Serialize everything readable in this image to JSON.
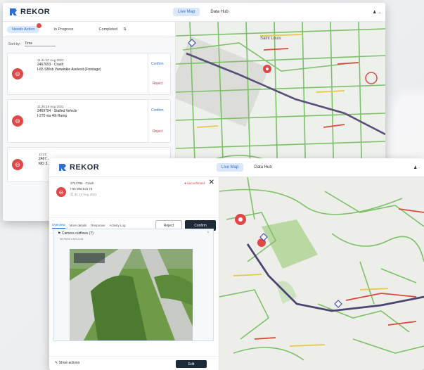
{
  "app": {
    "name": "REKOR",
    "nav": [
      "Live Map",
      "Data Hub"
    ]
  },
  "back": {
    "subtabs": [
      "Needs Action",
      "In Progress",
      "Completed"
    ],
    "sort_label": "Sort by:",
    "sort_value": "Time",
    "cards": [
      {
        "time": "11:41:37 Aug 2021",
        "id": "2467653 · Crash",
        "desc": "I-65 SB/sb Vanwinkle Ave/exit (Frontage)",
        "confirm": "Confirm",
        "reject": "Reject"
      },
      {
        "time": "11:36:18 Aug 2021",
        "id": "2469794 · Stalled Vehicle",
        "desc": "I-270 via 4th Ramp",
        "confirm": "Confirm",
        "reject": "Reject"
      },
      {
        "time": "11:21:",
        "id": "2467...",
        "desc": "MO 3...",
        "confirm": "",
        "reject": ""
      }
    ]
  },
  "front": {
    "incident_id": "2743796 · Crash",
    "incident_loc": "I-65 WB Exit 73",
    "incident_time": "11:41 13 Aug 2021",
    "status": "● unconfirmed",
    "tabs": [
      "Overview",
      "More details",
      "Response",
      "Activity Log"
    ],
    "reject": "Reject",
    "confirm": "Confirm",
    "camera_title": "Camera outflows (7)",
    "camera_meta": "SB PAGE 5 NO-2134",
    "show_actions": "Show actions",
    "edit": "Edit"
  },
  "colors": {
    "accent": "#2f6fd1",
    "alert": "#e04848",
    "dark": "#1f2a38"
  }
}
